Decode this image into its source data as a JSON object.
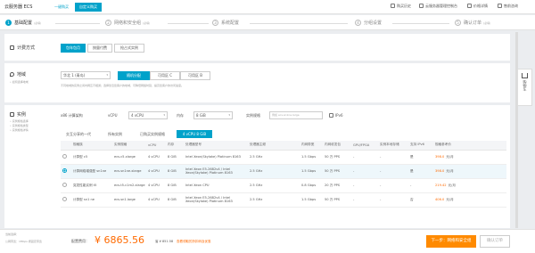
{
  "topbar": {
    "brand": "云服务器 ECS",
    "tab_quick": "一键购买",
    "tab_custom": "自定义购买",
    "links": [
      "购买历史",
      "云服务器管理控制台",
      "价格详情",
      "售前咨询"
    ]
  },
  "steps": [
    {
      "num": "1",
      "label": "基础配置",
      "sub": "(必填)"
    },
    {
      "num": "2",
      "label": "网络和安全组",
      "sub": "(必填)"
    },
    {
      "num": "3",
      "label": "系统配置",
      "sub": ""
    },
    {
      "num": "4",
      "label": "分组设置",
      "sub": ""
    },
    {
      "num": "5",
      "label": "确认订单",
      "sub": "(必填)"
    }
  ],
  "billing": {
    "title": "计费方式",
    "options": [
      "包年包月",
      "按量付费",
      "抢占式实例"
    ]
  },
  "region": {
    "title": "地域",
    "hint": "• 如何选择地域",
    "dropdown": "华北 1 (青岛)",
    "zones": [
      "随机分配",
      "可用区 C",
      "可用区 B"
    ],
    "note": "不同地域的实例之间内网互不相通；选择靠近您客户的地域，可降低网络时延、提高您客户的访问速度。"
  },
  "instance": {
    "title": "实例",
    "hints": [
      "• 实例规格选择",
      "• 实例规格类型",
      "• 实例规格详情"
    ],
    "filters": {
      "arch_label": "x86 计算架构",
      "vcpu_label": "vCPU",
      "vcpu_value": "4 vCPU",
      "mem_label": "内存",
      "mem_value": "8 GiB",
      "spec_label": "实例规格",
      "spec_placeholder": "例如 ecs.sn1ne.large",
      "ipv6_label": "IPv6"
    },
    "tabs": [
      "交互分享的一代",
      "所有实例",
      "已购买实例规格",
      "4 vCPU 8 GiB"
    ],
    "columns": [
      "规格族",
      "实例规格",
      "vCPU",
      "内存",
      "处理器型号",
      "处理器主频",
      "内网带宽",
      "内网收发包",
      "GPU/FPGA",
      "实例本地存储",
      "支持 IPv6",
      "规格参考价"
    ],
    "rows": [
      {
        "family": "计算型 c5",
        "spec": "ecs.c5.xlarge",
        "vcpu": "4 vCPU",
        "mem": "8 GiB",
        "cpu": "Intel Xeon(Skylake) Platinum 8163",
        "freq": "2.5 GHz",
        "bw": "1.5 Gbps",
        "pps": "50 万 PPS",
        "gpu": "-",
        "disk": "-",
        "ipv6": "是",
        "price": "398.0",
        "unit": "元/月"
      },
      {
        "family": "计算网络增强型 sn1ne",
        "spec": "ecs.sn1ne.xlarge",
        "vcpu": "4 vCPU",
        "mem": "8 GiB",
        "cpu": "Intel Xeon E5-2682v4 / Intel Xeon(Skylake) Platinum 8163",
        "freq": "2.5 GHz",
        "bw": "1.5 Gbps",
        "pps": "50 万 PPS",
        "gpu": "-",
        "disk": "-",
        "ipv6": "是",
        "price": "398.0",
        "unit": "元/月"
      },
      {
        "family": "突发性能实例 t5",
        "spec": "ecs.t5-c1m2.xlarge",
        "vcpu": "4 vCPU",
        "mem": "8 GiB",
        "cpu": "Intel Xeon CPU",
        "freq": "2.5 GHz",
        "bw": "0.8 Gbps",
        "pps": "20 万 PPS",
        "gpu": "-",
        "disk": "-",
        "ipv6": "-",
        "price": "219.42",
        "unit": "元/月"
      },
      {
        "family": "计算型 sn1 ne",
        "spec": "ecs.sn1.large",
        "vcpu": "4 vCPU",
        "mem": "8 GiB",
        "cpu": "Intel Xeon E5-2682v4 / Intel Xeon(Skylake) Platinum 8163",
        "freq": "2.5 GHz",
        "bw": "1.5 Gbps",
        "pps": "50 万 PPS",
        "gpu": "-",
        "disk": "-",
        "ipv6": "否",
        "price": "406.0",
        "unit": "元/月"
      }
    ],
    "selected_row": 1
  },
  "bottom": {
    "label": "配置费用：",
    "price": "¥ 6865.56",
    "discount": "省 ¥ 851.58",
    "discount_link": "查看领取的折扣码及优惠",
    "sub1": "当前选择：",
    "sub2": "公网带宽：1Mbps 按固定带宽",
    "next_button": "下一步：网络和安全组",
    "confirm_button": "确认订单"
  },
  "cart": {
    "label": "购物车"
  },
  "colors": {
    "accent": "#00a2ca",
    "price": "#ff6a00",
    "next_button": "#ff8a00"
  }
}
